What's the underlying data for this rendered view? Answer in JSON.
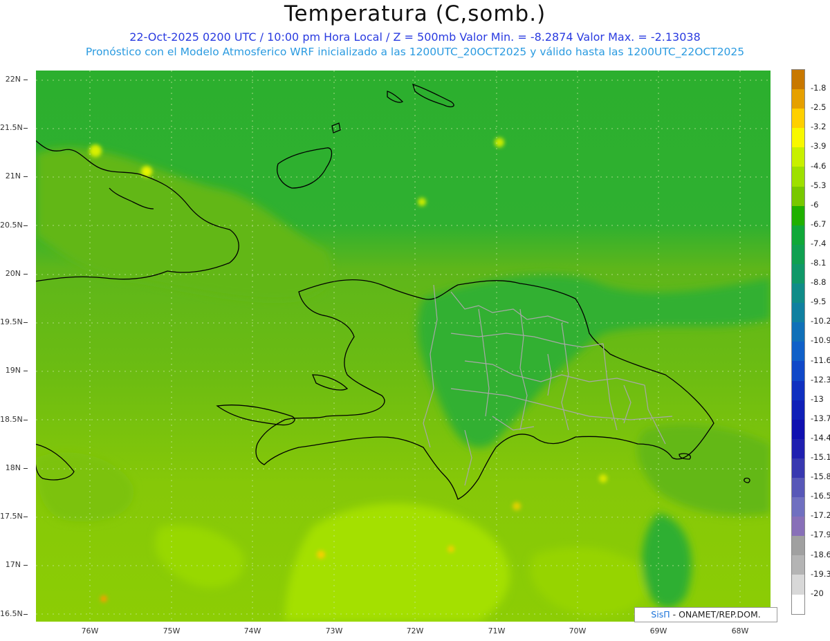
{
  "title": "Temperatura (C,somb.)",
  "subtitle1": "22-Oct-2025  0200 UTC / 10:00 pm Hora Local / Z = 500mb  Valor Min. = -8.2874  Valor Max. = -2.13038",
  "subtitle2": "Pronóstico con el Modelo Atmosferico WRF inicializado a las 1200UTC_20OCT2025 y válido hasta las  1200UTC_22OCT2025",
  "y_ticks": [
    "22N",
    "21.5N",
    "21N",
    "20.5N",
    "20N",
    "19.5N",
    "19N",
    "18.5N",
    "18N",
    "17.5N",
    "17N",
    "16.5N"
  ],
  "x_ticks": [
    "76W",
    "75W",
    "74W",
    "73W",
    "72W",
    "71W",
    "70W",
    "69W",
    "68W"
  ],
  "colorbar": {
    "labels": [
      "-1.8",
      "-2.5",
      "-3.2",
      "-3.9",
      "-4.6",
      "-5.3",
      "-6",
      "-6.7",
      "-7.4",
      "-8.1",
      "-8.8",
      "-9.5",
      "-10.2",
      "-10.9",
      "-11.6",
      "-12.3",
      "-13",
      "-13.7",
      "-14.4",
      "-15.1",
      "-15.8",
      "-16.5",
      "-17.2",
      "-17.9",
      "-18.6",
      "-19.3",
      "-20"
    ],
    "colors": [
      "#c87800",
      "#e6a000",
      "#ffd000",
      "#f8f800",
      "#c8f000",
      "#9ee000",
      "#78c800",
      "#20b000",
      "#10a838",
      "#10a050",
      "#109868",
      "#108c88",
      "#1080a0",
      "#1070b8",
      "#1060c8",
      "#1048c8",
      "#1030c0",
      "#1020b8",
      "#1010b0",
      "#2020b0",
      "#3838b0",
      "#5858b8",
      "#7070c0",
      "#8870b8",
      "#a0a0a0",
      "#b4b4b4",
      "#d8d8d8",
      "#ffffff"
    ]
  },
  "credit": {
    "brand": "SisΠ",
    "text": " - ONAMET/REP.DOM."
  },
  "colors": {
    "ocean_north": "#30b030",
    "mid_zone": "#70b810",
    "south_zone": "#9bd800",
    "bright_patch": "#c4f000",
    "coast": "#000000",
    "provinces": "#a8a8a8"
  }
}
